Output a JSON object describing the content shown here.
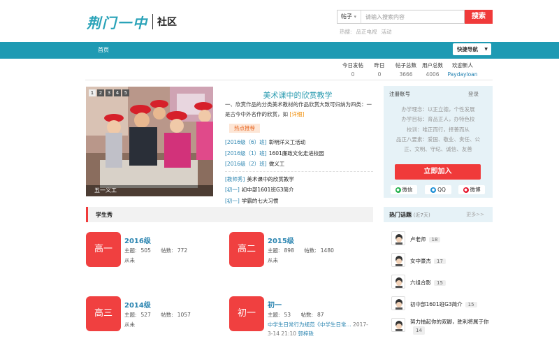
{
  "header": {
    "logo_calligraphy": "荆门一中",
    "logo_sub": "社区",
    "search": {
      "category": "帖子",
      "placeholder": "请输入搜索内容",
      "button": "搜索"
    },
    "hot_words": [
      "热搜:",
      "品正电视",
      "活动"
    ]
  },
  "nav": {
    "home": "首页",
    "quick_nav": "快捷导航"
  },
  "stats": [
    {
      "label": "今日发帖",
      "value": "0"
    },
    {
      "label": "昨日",
      "value": "0"
    },
    {
      "label": "帖子总数",
      "value": "3666"
    },
    {
      "label": "用户总数",
      "value": "4006"
    },
    {
      "label": "欢迎新人",
      "value": "Paydayloan"
    }
  ],
  "hero": {
    "tabs": [
      "1",
      "2",
      "3",
      "4",
      "5"
    ],
    "active_tab": 0,
    "caption": "五一义工"
  },
  "featured": {
    "title": "美术课中的欣赏教学",
    "desc": "一、欣赏作品的分类美术教材的作品欣赏大致可归纳为四类：一是古今中外名作的欣赏，如",
    "more": "[详细]",
    "hot_badge": "热点推荐"
  },
  "news_group1": [
    {
      "tag": "[2016级（6）班]",
      "text": "彰明洋义工活动"
    },
    {
      "tag": "[2016级（1）班]",
      "text": "1601廉政文化走进校园"
    },
    {
      "tag": "[2016级（2）班]",
      "text": "做义工"
    }
  ],
  "news_group2": [
    {
      "tag": "[教师秀]",
      "text": "美术课中的欣赏教学"
    },
    {
      "tag": "[初一]",
      "text": "初中部1601班G3简介"
    },
    {
      "tag": "[初一]",
      "text": "学霸的七大习惯"
    }
  ],
  "students": {
    "title": "学生秀",
    "grades": [
      {
        "icon": "高一",
        "name": "2016级",
        "topics_label": "主题:",
        "topics": "505",
        "posts_label": "帖数:",
        "posts": "772",
        "latest": "从未"
      },
      {
        "icon": "高二",
        "name": "2015级",
        "topics_label": "主题:",
        "topics": "898",
        "posts_label": "帖数:",
        "posts": "1480",
        "latest": "从未"
      },
      {
        "icon": "高三",
        "name": "2014级",
        "topics_label": "主题:",
        "topics": "527",
        "posts_label": "帖数:",
        "posts": "1057",
        "latest": "从未"
      },
      {
        "icon": "初一",
        "name": "初一",
        "topics_label": "主题:",
        "topics": "53",
        "posts_label": "帖数:",
        "posts": "87",
        "latest_title": "中学生日常行为规范《中学生日常...",
        "latest_time": "2017-3-14 21:10",
        "latest_user": "郭梓轶"
      }
    ]
  },
  "register": {
    "head": "注册账号",
    "login": "登录",
    "motto": [
      "办学理念：以正立德，个性发展",
      "办学目标：育品正人，办特色校",
      "校训：唯正而行，择善而从",
      "品正八要素：爱国、敬业、责任、公",
      "正、文明、守纪、诚信、友善"
    ],
    "join": "立即加入",
    "social": [
      "微信",
      "QQ",
      "微博"
    ]
  },
  "topics": {
    "title": "热门话题",
    "sub": "(近7天)",
    "more": "更多>>",
    "items": [
      {
        "title": "卢老师",
        "count": "18"
      },
      {
        "title": "女中豪杰",
        "count": "17"
      },
      {
        "title": "六组合影",
        "count": "15"
      },
      {
        "title": "初中部1601班G3简介",
        "count": "15"
      },
      {
        "title": "努力抽起你的双脚，胜利将属于你",
        "count": "14"
      }
    ]
  },
  "colors": {
    "brand": "#1e9ab3",
    "accent_red": "#f03a3a",
    "link_blue": "#2a84b0"
  }
}
